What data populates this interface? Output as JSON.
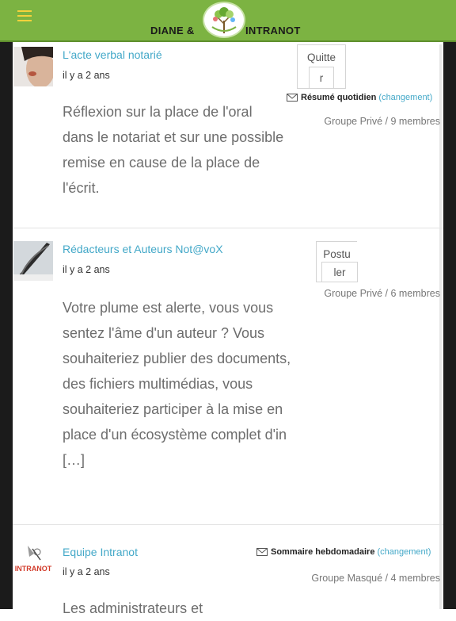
{
  "header": {
    "brand_left": "DIANE &",
    "brand_right": "INTRANOT",
    "colors": {
      "bar": "#7cb342",
      "menu_icon": "#f4d23c",
      "link": "#43a8c8"
    }
  },
  "groups": [
    {
      "name": "L'acte verbal notarié",
      "time": "il y a 2 ans",
      "action_label_line1": "Quitte",
      "action_label_line2": "r",
      "subscription": "Résumé quotidien",
      "change_link": "(changement)",
      "meta": "Groupe Privé / 9 membres",
      "description": "Réflexion sur la place de l'oral dans le notariat et sur une possible remise en cause de la place de l'écrit."
    },
    {
      "name": "Rédacteurs et Auteurs Not@voX",
      "time": "il y a 2 ans",
      "action_label_line1": "Postu",
      "action_label_line2": "ler",
      "meta": "Groupe Privé / 6 membres",
      "description": "Votre plume est alerte, vous vous sentez l'âme d'un auteur ? Vous souhaiteriez publier des documents, des fichiers multimédias, vous souhaiteriez participer à la mise en place d'un écosystème complet d'in […]"
    },
    {
      "name": "Equipe Intranot",
      "time": "il y a 2 ans",
      "subscription": "Sommaire hebdomadaire",
      "change_link": "(changement)",
      "meta": "Groupe Masqué / 4 membres",
      "description": "Les administrateurs et",
      "avatar_text": "INTRANOT"
    }
  ]
}
